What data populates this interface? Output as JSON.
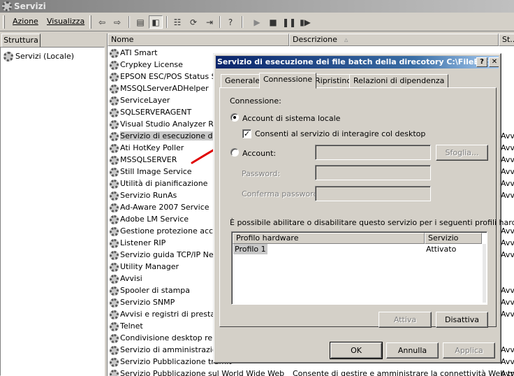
{
  "window": {
    "title": "Servizi"
  },
  "menu": {
    "azione": "Azione",
    "visualizza": "Visualizza"
  },
  "toolbar": {
    "icons": [
      "back-arrow-icon",
      "forward-arrow-icon",
      "folder-up-icon",
      "show-tree-icon",
      "properties-icon",
      "refresh-icon",
      "export-list-icon",
      "help-icon",
      "play-icon",
      "stop-icon",
      "pause-icon",
      "restart-icon"
    ]
  },
  "tree": {
    "tab": "Struttura",
    "root": "Servizi (Locale)"
  },
  "list": {
    "columns": {
      "name": "Nome",
      "description": "Descrizione",
      "status": "St.."
    },
    "rows": [
      {
        "name": "ATI Smart",
        "desc": "",
        "st": ""
      },
      {
        "name": "Crypkey License",
        "desc": "",
        "st": ""
      },
      {
        "name": "EPSON ESC/POS Status Ser",
        "desc": "",
        "st": ""
      },
      {
        "name": "MSSQLServerADHelper",
        "desc": "",
        "st": ""
      },
      {
        "name": "ServiceLayer",
        "desc": "",
        "st": ""
      },
      {
        "name": "SQLSERVERAGENT",
        "desc": "",
        "st": ""
      },
      {
        "name": "Visual Studio Analyzer RPC I",
        "desc": "",
        "st": ""
      },
      {
        "name": "Servizio di esecuzione dei fil",
        "desc": "",
        "st": "Avv"
      },
      {
        "name": "Ati HotKey Poller",
        "desc": "",
        "st": "Avv"
      },
      {
        "name": "MSSQLSERVER",
        "desc": "",
        "st": "Avv"
      },
      {
        "name": "Still Image Service",
        "desc": "",
        "st": "Avv"
      },
      {
        "name": "Utilità di pianificazione",
        "desc": "",
        "st": "Avv"
      },
      {
        "name": "Servizio RunAs",
        "desc": "",
        "st": "Avv"
      },
      {
        "name": "Ad-Aware 2007 Service",
        "desc": "",
        "st": ""
      },
      {
        "name": "Adobe LM Service",
        "desc": "",
        "st": ""
      },
      {
        "name": "Gestione protezione accoun",
        "desc": "",
        "st": "Avv"
      },
      {
        "name": "Listener RIP",
        "desc": "",
        "st": "Avv"
      },
      {
        "name": "Servizio guida TCP/IP NetBI",
        "desc": "",
        "st": "Avv"
      },
      {
        "name": "Utility Manager",
        "desc": "",
        "st": ""
      },
      {
        "name": "Avvisi",
        "desc": "",
        "st": ""
      },
      {
        "name": "Spooler di stampa",
        "desc": "",
        "st": "Avv"
      },
      {
        "name": "Servizio SNMP",
        "desc": "",
        "st": "Avv"
      },
      {
        "name": "Avvisi e registri di prestazio",
        "desc": "",
        "st": "Avv"
      },
      {
        "name": "Telnet",
        "desc": "",
        "st": ""
      },
      {
        "name": "Condivisione desktop remot",
        "desc": "",
        "st": ""
      },
      {
        "name": "Servizio di amministrazione c",
        "desc": "",
        "st": "Avv"
      },
      {
        "name": "Servizio Pubblicazione tramit",
        "desc": "",
        "st": "Avv"
      },
      {
        "name": "Servizio Pubblicazione sul World Wide Web",
        "desc": "Consente di gestire e amministrare la connettività Web tr",
        "st": "Avv"
      }
    ]
  },
  "dialog": {
    "title": "Servizio di esecuzione dei file batch della direcotory C:\\FileBatS...",
    "help_btn": "?",
    "close_btn": "✕",
    "tabs": [
      "Generale",
      "Connessione",
      "Ripristino",
      "Relazioni di dipendenza"
    ],
    "connection_label": "Connessione:",
    "local_account": "Account di sistema locale",
    "interact_desktop": "Consenti al servizio di interagire col desktop",
    "interact_checked": true,
    "account_label": "Account:",
    "browse": "Sfoglia...",
    "password_label": "Password:",
    "confirm_label": "Conferma password:",
    "hw_text": "È possibile abilitare o disabilitare questo servizio per i seguenti profili hardware:",
    "hw_columns": [
      "Profilo hardware",
      "Servizio"
    ],
    "hw_rows": [
      {
        "profile": "Profilo 1",
        "service": "Attivato"
      }
    ],
    "enable": "Attiva",
    "disable": "Disattiva",
    "ok": "OK",
    "cancel": "Annulla",
    "apply": "Applica"
  },
  "annotation": {
    "color": "#e00000"
  }
}
